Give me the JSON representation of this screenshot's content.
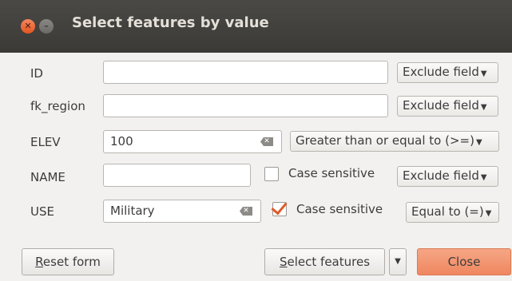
{
  "window": {
    "title": "Select features by value",
    "controls": {
      "close_icon": "close-icon",
      "minimize_icon": "minimize-icon"
    }
  },
  "rows": [
    {
      "label": "ID",
      "value": "",
      "mode": "Exclude field"
    },
    {
      "label": "fk_region",
      "value": "",
      "mode": "Exclude field"
    },
    {
      "label": "ELEV",
      "value": "100",
      "mode": "Greater than or equal to (>=)"
    },
    {
      "label": "NAME",
      "value": "",
      "case_label": "Case sensitive",
      "case_checked": false,
      "mode": "Exclude field"
    },
    {
      "label": "USE",
      "value": "Military",
      "case_label": "Case sensitive",
      "case_checked": true,
      "mode": "Equal to (=)"
    }
  ],
  "buttons": {
    "reset_rest": "eset form",
    "reset_acc": "R",
    "select_acc": "S",
    "select_rest": "elect features",
    "close": "Close"
  },
  "colors": {
    "accent": "#ef8760",
    "titlebar": "#3d3c38",
    "background": "#f2f1f0"
  }
}
